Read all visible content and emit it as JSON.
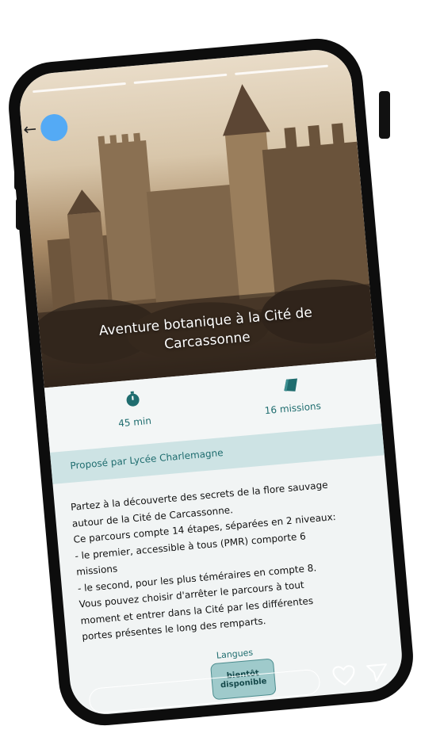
{
  "story": {
    "progress_segments": [
      1,
      1,
      1
    ]
  },
  "hero": {
    "title": "Aventure botanique à la Cité de Carcassonne"
  },
  "stats": {
    "duration": "45 min",
    "missions": "16 missions",
    "duration_icon": "stopwatch-icon",
    "missions_icon": "map-icon"
  },
  "organizer": {
    "label": "Proposé par Lycée Charlemagne"
  },
  "description": {
    "lines": [
      "Partez à la découverte des secrets de la flore sauvage",
      "autour de la Cité de Carcassonne.",
      "Ce parcours compte 14 étapes, séparées en 2 niveaux:",
      "- le premier, accessible à tous (PMR) comporte 6",
      "missions",
      "- le second, pour les plus téméraires en compte 8.",
      "Vous pouvez choisir d'arrêter le parcours à tout",
      "moment et entrer dans la Cité par les différentes",
      "portes présentes le long des remparts."
    ]
  },
  "languages": {
    "label": "Langues",
    "badge_line1": "bientôt",
    "badge_line2": "disponible"
  },
  "colors": {
    "accent": "#1f6d6f",
    "avatar": "#54aaf5",
    "org_bar": "#cde3e4",
    "badge": "#9fcacb"
  }
}
